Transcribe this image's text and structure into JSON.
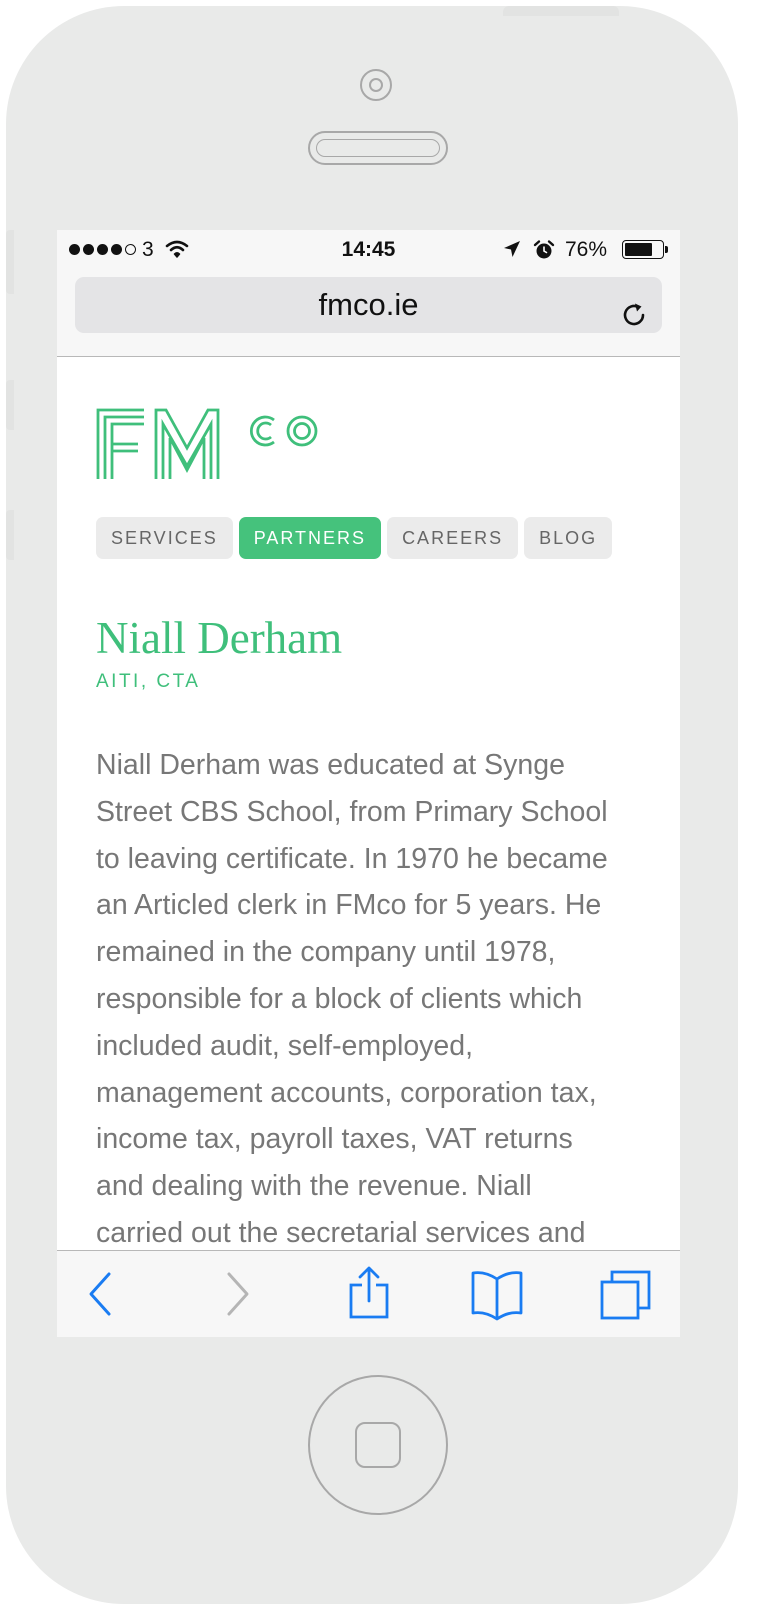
{
  "status_bar": {
    "carrier": "3",
    "time": "14:45",
    "battery_percent": "76%",
    "battery_level": 0.76,
    "signal_bars_filled": 4,
    "signal_bars_total": 5
  },
  "browser": {
    "url": "fmco.ie"
  },
  "site": {
    "logo_text": "FMco",
    "brand_color": "#45c27c",
    "nav": [
      {
        "label": "SERVICES",
        "active": false
      },
      {
        "label": "PARTNERS",
        "active": true
      },
      {
        "label": "CAREERS",
        "active": false
      },
      {
        "label": "BLOG",
        "active": false
      }
    ]
  },
  "profile": {
    "name": "Niall Derham",
    "qualifications": "AITI, CTA",
    "bio_lines": [
      "Niall Derham was educated at Synge",
      "Street CBS School, from Primary School",
      "to leaving certificate. In 1970 he became",
      "an Articled clerk in FMco for 5 years. He",
      "remained in the company until 1978,",
      "responsible for a block of clients which",
      "included audit, self-employed,",
      "management accounts, corporation tax,",
      "income tax, payroll taxes, VAT returns",
      "and dealing with the revenue. Niall",
      "carried out the secretarial services and"
    ]
  },
  "toolbar": {
    "icons": [
      "back-icon",
      "forward-icon",
      "share-icon",
      "bookmarks-icon",
      "tabs-icon"
    ],
    "accent_color": "#1a7cf2"
  }
}
